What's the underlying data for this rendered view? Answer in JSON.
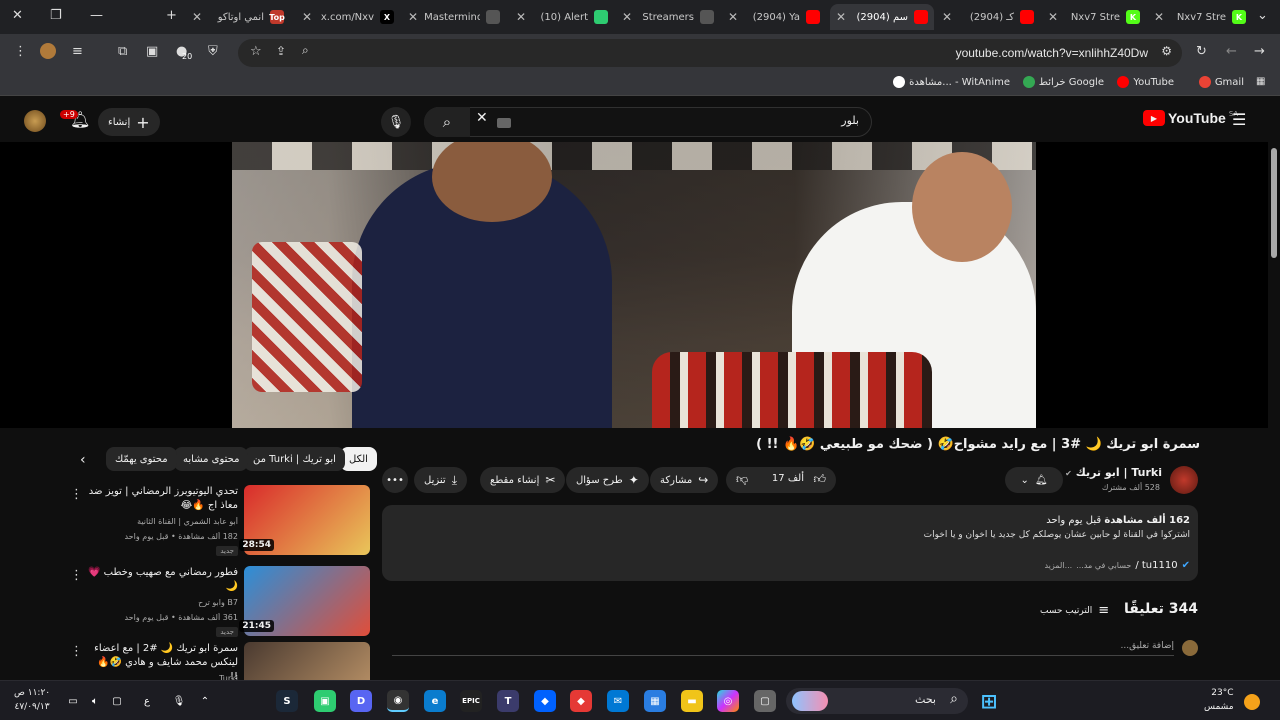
{
  "browser": {
    "tabs": [
      {
        "label": "انمي اوتاكو",
        "icon_text": "Top",
        "icon_color": "#c0392b"
      },
      {
        "label": "x.com/Nxv",
        "icon_text": "X",
        "icon_color": "#000000"
      },
      {
        "label": "Mastermind",
        "icon_text": "",
        "icon_color": "#555555"
      },
      {
        "label": "(10) Alert",
        "icon_text": "",
        "icon_color": "#2ecc71"
      },
      {
        "label": "Streamers",
        "icon_text": "",
        "icon_color": "#555555"
      },
      {
        "label": "(2904) Ya",
        "icon_text": "",
        "icon_color": "#ff0000"
      },
      {
        "label": "(2904) سم",
        "icon_text": "",
        "icon_color": "#ff0000"
      },
      {
        "label": "(2904) كـ",
        "icon_text": "",
        "icon_color": "#ff0000"
      },
      {
        "label": "Nxv7 Stre",
        "icon_text": "K",
        "icon_color": "#53fc18"
      },
      {
        "label": "Nxv7 Stre",
        "icon_text": "K",
        "icon_color": "#53fc18"
      }
    ],
    "url": "youtube.com/watch?v=xnlihhZ40Dw",
    "extension_badge": "20",
    "bookmarks": [
      {
        "label": "Gmail",
        "color": "#ea4335"
      },
      {
        "label": "YouTube",
        "color": "#ff0000"
      },
      {
        "label": "خرائط Google",
        "color": "#34a853"
      },
      {
        "label": "مشاهدة... - WitAnime",
        "color": "#ffffff"
      }
    ]
  },
  "youtube": {
    "logo": "YouTube",
    "region": "SA",
    "search_value": "بلور",
    "create_label": "إنشاء",
    "notif_count": "+9",
    "video": {
      "title": "سمرة ابو تريك 🌙 #3 | مع رايد مشواح🤣 ( ضحك مو طبيعي 🤣🔥 !! )",
      "channel": "Turki | ابو تريك",
      "subscribers": "528 ألف مشترك",
      "likes": "17 ألف",
      "actions": {
        "share": "مشاركة",
        "ask": "طرح سؤال",
        "clip": "إنشاء مقطع",
        "download": "تنزيل"
      },
      "description": {
        "views": "162 ألف مشاهدة",
        "time": "قبل يوم واحد",
        "text": "اشتركوا في القناة لو حابين عشان يوصلكم كل جديد يا اخوان و يا اخوات",
        "more": "...المزيد",
        "link_text": "tu1110 /",
        "link_tail": "حسابي في مد..."
      },
      "comments_count": "344 تعليقًا",
      "sort_label": "الترتيب حسب",
      "add_comment_placeholder": "إضافة تعليق..."
    },
    "chips": [
      "الكل",
      "من Turki | ابو تريك",
      "محتوى مشابه",
      "محتوى يهمّك"
    ],
    "recommendations": [
      {
        "title": "تحدي اليوتيوبرز الرمضاني | تويز ضد معاذ اج 🔥😂",
        "channel": "أبو عابد الشمري | القناة الثانية",
        "meta": "182 ألف مشاهدة • قبل يوم واحد",
        "badge": "جديد",
        "duration": "28:54",
        "colors": [
          "#d92b2b",
          "#e9c65a"
        ]
      },
      {
        "title": "فطور رمضاني مع صهيب وخطب 💗🌙",
        "channel": "B7 وابو ترح",
        "meta": "361 ألف مشاهدة • قبل يوم واحد",
        "badge": "جديد",
        "duration": "21:45",
        "colors": [
          "#2b8fd9",
          "#e04e3a"
        ]
      },
      {
        "title": "سمرة ابو تريك 🌙 #2 | مع اعضاء لينكس محمد شايف و هادي 🤣🔥 !!",
        "channel": "Turki",
        "meta": "",
        "badge": "",
        "duration": "",
        "colors": [
          "#4a3a30",
          "#c49a6c"
        ]
      }
    ]
  },
  "taskbar": {
    "weather_temp": "23°C",
    "weather_desc": "مشمس",
    "search_label": "بحث",
    "time": "١١:٢٠ ص",
    "date": "٤٧/٠٩/١٣",
    "lang": "ع"
  }
}
